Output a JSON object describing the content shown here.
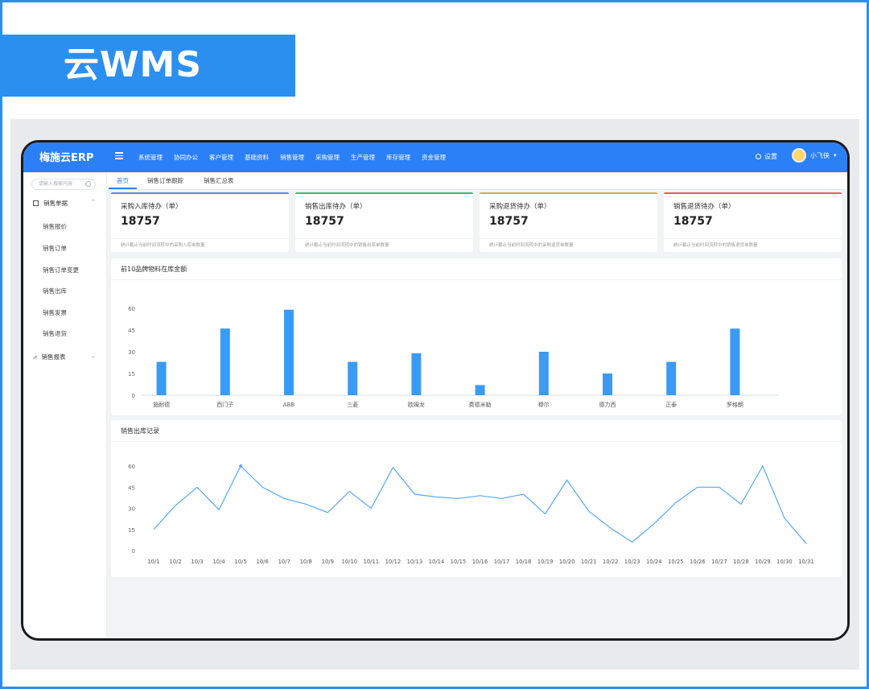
{
  "banner": {
    "title": "云WMS"
  },
  "app": {
    "brand": "梅施云ERP"
  },
  "nav": {
    "items": [
      "系统管理",
      "协同办公",
      "客户管理",
      "基础资料",
      "销售管理",
      "采购管理",
      "生产管理",
      "库存管理",
      "资金管理"
    ]
  },
  "header": {
    "settings_label": "设置",
    "user_name": "小飞侠"
  },
  "sidebar": {
    "search_placeholder": "请输入搜索内容",
    "group_sales_docs": "销售单据",
    "items": [
      "销售报价",
      "销售订单",
      "销售订单变更",
      "销售出库",
      "销售发票",
      "销售退货"
    ],
    "group_sales_reports": "销售报表"
  },
  "tabs": [
    "首页",
    "销售订单跟踪",
    "销售汇总表"
  ],
  "stats": [
    {
      "title": "采购入库待办（单）",
      "value": "18757",
      "desc": "统计截止当前时间流转中的采购入库单数量",
      "color": "#4b8ef5"
    },
    {
      "title": "销售出库待办（单）",
      "value": "18757",
      "desc": "统计截止当前时间流转中的销售出库单数量",
      "color": "#2fc27a"
    },
    {
      "title": "采购退货待办（单）",
      "value": "18757",
      "desc": "统计截止当前时间流转中的采购退货单数量",
      "color": "#f3a23a"
    },
    {
      "title": "销售退货待办（单）",
      "value": "18757",
      "desc": "统计截止当前时间流转中的销售退货单数量",
      "color": "#ef5a5a"
    }
  ],
  "chart_data": [
    {
      "type": "bar",
      "title": "前10品牌物料在库金额",
      "categories": [
        "施耐德",
        "西门子",
        "ABB",
        "三菱",
        "欧姆龙",
        "费德米勒",
        "穆尔",
        "德力西",
        "正泰",
        "罗格朗"
      ],
      "values": [
        23,
        46,
        59,
        23,
        29,
        7,
        30,
        15,
        23,
        46
      ],
      "ylim": [
        0,
        60
      ],
      "yticks": [
        0,
        15,
        30,
        45,
        60
      ],
      "grid": false,
      "color": "#3a9bf5"
    },
    {
      "type": "line",
      "title": "销售出库记录",
      "x": [
        "10/1",
        "10/2",
        "10/3",
        "10/4",
        "10/5",
        "10/6",
        "10/7",
        "10/8",
        "10/9",
        "10/10",
        "10/11",
        "10/12",
        "10/13",
        "10/14",
        "10/15",
        "10/16",
        "10/17",
        "10/18",
        "10/19",
        "10/20",
        "10/21",
        "10/22",
        "10/23",
        "10/24",
        "10/25",
        "10/26",
        "10/27",
        "10/28",
        "10/29",
        "10/30",
        "10/31"
      ],
      "values": [
        15,
        32,
        45,
        29,
        60,
        45,
        37,
        33,
        27,
        42,
        30,
        59,
        40,
        38,
        37,
        39,
        37,
        40,
        26,
        50,
        28,
        16,
        6,
        19,
        34,
        45,
        45,
        33,
        60,
        23,
        5
      ],
      "ylim": [
        0,
        60
      ],
      "yticks": [
        0,
        15,
        30,
        45,
        60
      ],
      "grid": false,
      "color": "#5aa7f3"
    }
  ]
}
